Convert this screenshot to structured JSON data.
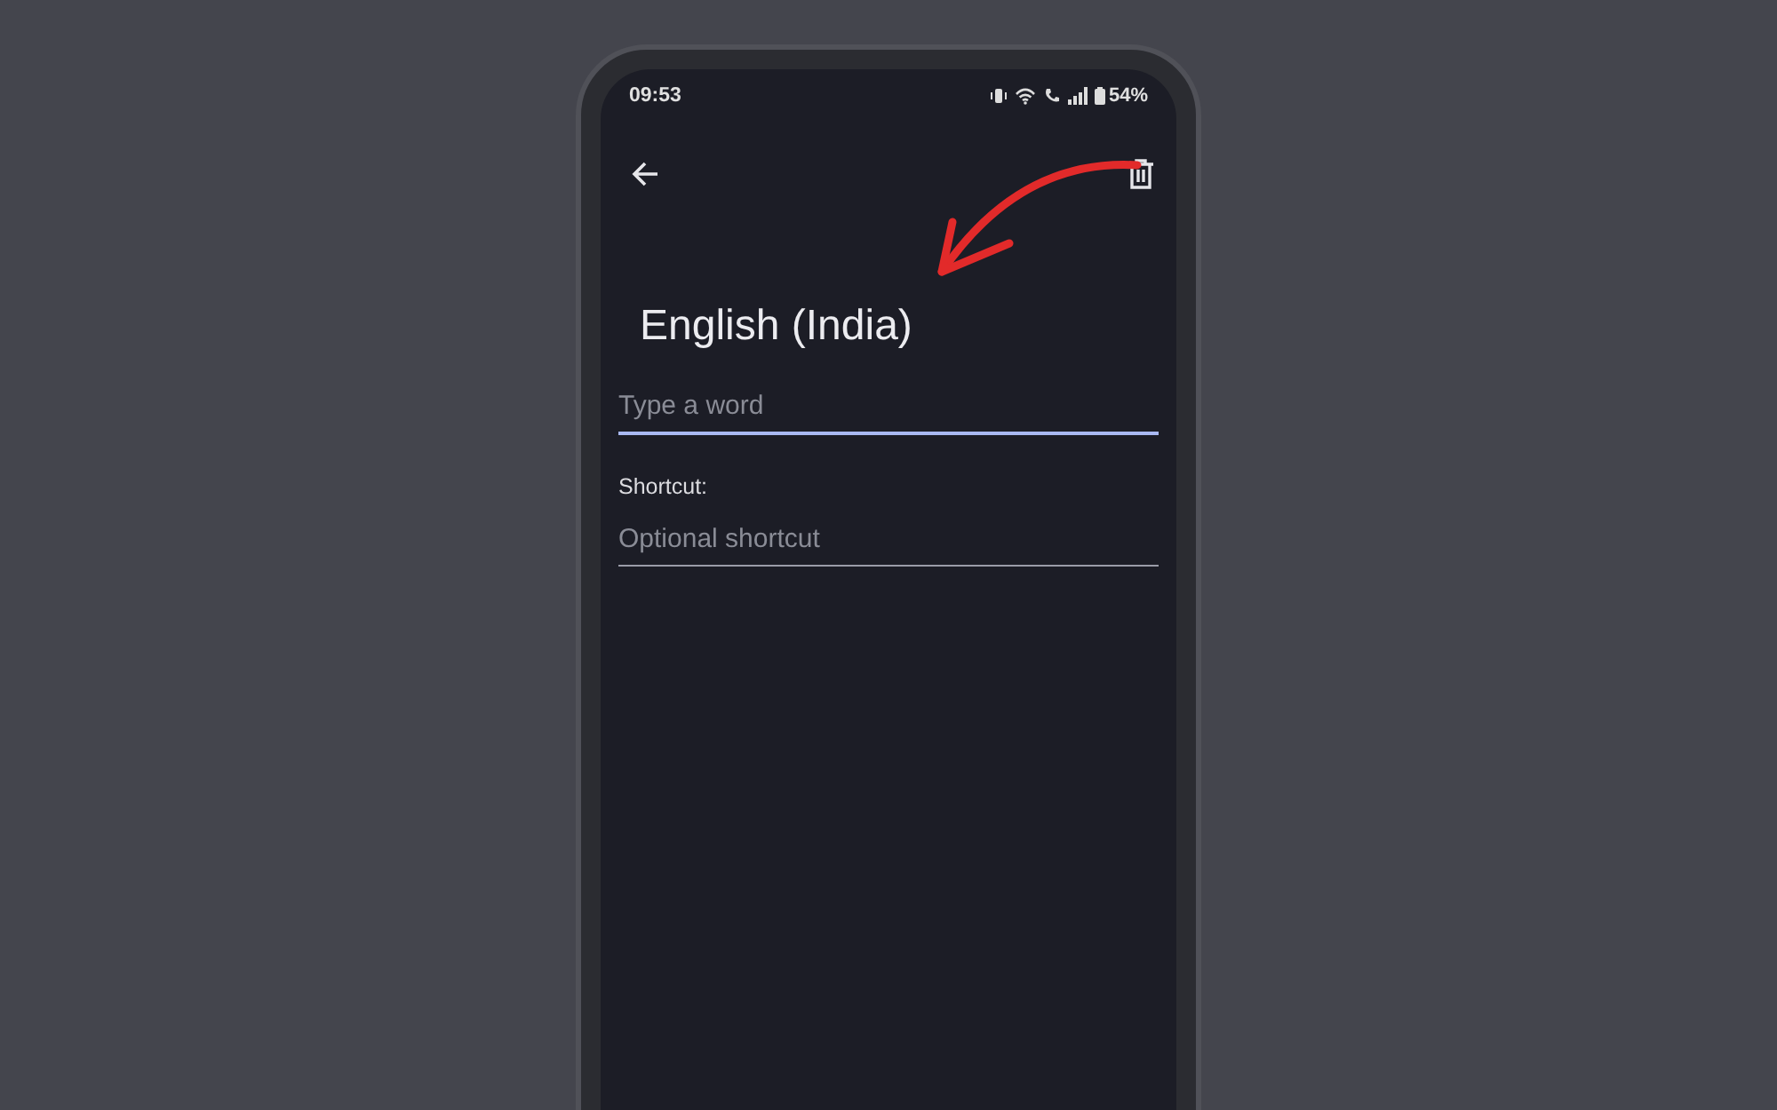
{
  "status_bar": {
    "time": "09:53",
    "battery": "54%"
  },
  "title": "English (India)",
  "fields": [
    {
      "kind": "input",
      "placeholder": "Type a word",
      "focused": true
    },
    {
      "kind": "label",
      "text": "Shortcut:"
    },
    {
      "kind": "input",
      "placeholder": "Optional shortcut",
      "focused": false
    }
  ]
}
